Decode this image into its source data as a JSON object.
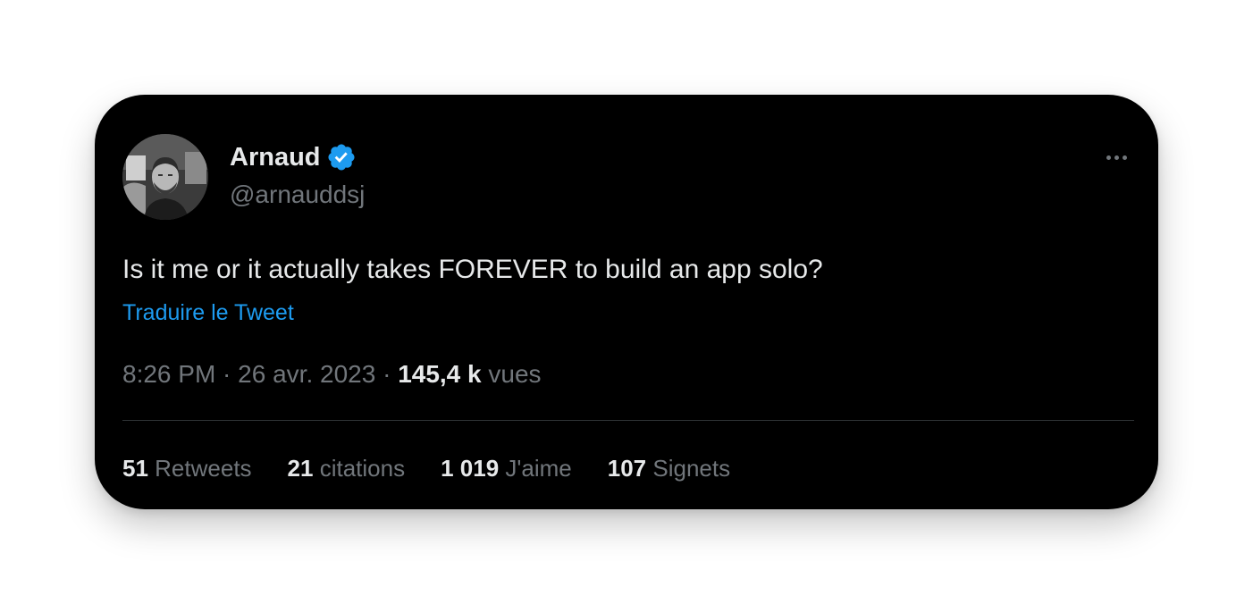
{
  "tweet": {
    "author": {
      "name": "Arnaud",
      "handle": "@arnauddsj",
      "verified": true
    },
    "text": "Is it me or it actually takes FOREVER to build an app solo?",
    "translate_label": "Traduire le Tweet",
    "meta": {
      "time": "8:26 PM",
      "separator": " · ",
      "date": "26 avr. 2023",
      "views_count": "145,4 k",
      "views_label": "vues"
    },
    "stats": [
      {
        "count": "51",
        "label": "Retweets"
      },
      {
        "count": "21",
        "label": "citations"
      },
      {
        "count": "1 019",
        "label": "J'aime"
      },
      {
        "count": "107",
        "label": "Signets"
      }
    ]
  },
  "colors": {
    "background": "#000000",
    "text_primary": "#e7e9ea",
    "text_secondary": "#71767b",
    "link": "#1d9bf0",
    "verified_badge": "#1d9bf0",
    "divider": "#2f3336"
  },
  "icons": {
    "verified": "verified-badge-icon",
    "more": "more-options-icon"
  }
}
